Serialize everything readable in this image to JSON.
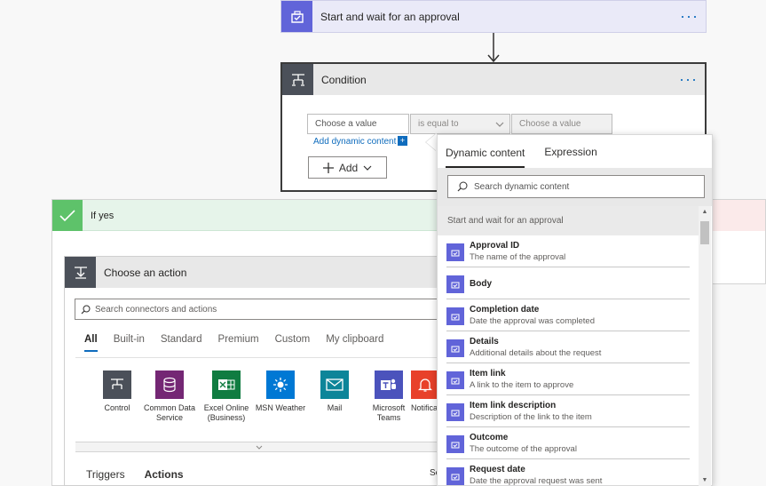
{
  "approval_step": {
    "title": "Start and wait for an approval",
    "menu": "…"
  },
  "condition": {
    "title": "Condition",
    "menu": "…",
    "left_placeholder": "Choose a value",
    "operator": "is equal to",
    "right_placeholder": "Choose a value",
    "add_dynamic_link": "Add dynamic content",
    "add_button": "Add"
  },
  "if_yes": {
    "label": "If yes"
  },
  "choose_action": {
    "title": "Choose an action",
    "search_placeholder": "Search connectors and actions",
    "tabs": [
      "All",
      "Built-in",
      "Standard",
      "Premium",
      "Custom",
      "My clipboard"
    ],
    "active_tab": "All",
    "tiles": [
      {
        "label": "Control",
        "icon": "control-icon",
        "color": "#4b5059"
      },
      {
        "label": "Common Data Service",
        "icon": "database-icon",
        "color": "#742774"
      },
      {
        "label": "Excel Online (Business)",
        "icon": "excel-icon",
        "color": "#107c41"
      },
      {
        "label": "MSN Weather",
        "icon": "weather-icon",
        "color": "#0078d4"
      },
      {
        "label": "Mail",
        "icon": "mail-icon",
        "color": "#0d8599"
      },
      {
        "label": "Microsoft Teams",
        "icon": "teams-icon",
        "color": "#4b53bc"
      },
      {
        "label": "Notificat",
        "icon": "notification-icon",
        "color": "#e8412a"
      }
    ],
    "bottom_tabs": [
      "Triggers",
      "Actions"
    ],
    "bottom_active": "Actions",
    "see_more": "Se"
  },
  "dynamic_panel": {
    "tabs": [
      "Dynamic content",
      "Expression"
    ],
    "active_tab": "Dynamic content",
    "search_placeholder": "Search dynamic content",
    "section": "Start and wait for an approval",
    "items": [
      {
        "name": "Approval ID",
        "desc": "The name of the approval"
      },
      {
        "name": "Body",
        "desc": ""
      },
      {
        "name": "Completion date",
        "desc": "Date the approval was completed"
      },
      {
        "name": "Details",
        "desc": "Additional details about the request"
      },
      {
        "name": "Item link",
        "desc": "A link to the item to approve"
      },
      {
        "name": "Item link description",
        "desc": "Description of the link to the item"
      },
      {
        "name": "Outcome",
        "desc": "The outcome of the approval"
      },
      {
        "name": "Request date",
        "desc": "Date the approval request was sent"
      }
    ]
  },
  "colors": {
    "accent": "#0f6cbd",
    "approval": "#6164d9",
    "yes": "#5ec26a"
  }
}
